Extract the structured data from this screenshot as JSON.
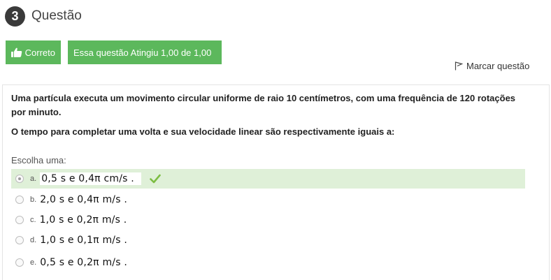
{
  "header": {
    "number": "3",
    "title": "Questão"
  },
  "status": {
    "result_label": "Correto",
    "score_label": "Essa questão Atingiu 1,00 de 1,00"
  },
  "flag": {
    "label": "Marcar questão"
  },
  "question": {
    "text1": "Uma partícula executa um movimento circular uniforme de raio 10 centímetros, com uma frequência de 120 rotações por minuto.",
    "text2": "O tempo para completar uma volta e sua velocidade linear são respectivamente iguais a:"
  },
  "prompt": "Escolha uma:",
  "answers": [
    {
      "letter": "a.",
      "text": "0,5 s e  0,4π cm/s .",
      "selected": true,
      "correct": true
    },
    {
      "letter": "b.",
      "text": "2,0 s e  0,4π m/s .",
      "selected": false
    },
    {
      "letter": "c.",
      "text": "1,0 s e 0,2π m/s  .",
      "selected": false
    },
    {
      "letter": "d.",
      "text": "1,0 s e  0,1π m/s .",
      "selected": false
    },
    {
      "letter": "e.",
      "text": "0,5 s e  0,2π m/s .",
      "selected": false
    }
  ],
  "colors": {
    "success": "#5cb85c",
    "correct_row": "#dff0d8",
    "checkmark": "#7cbd42"
  }
}
